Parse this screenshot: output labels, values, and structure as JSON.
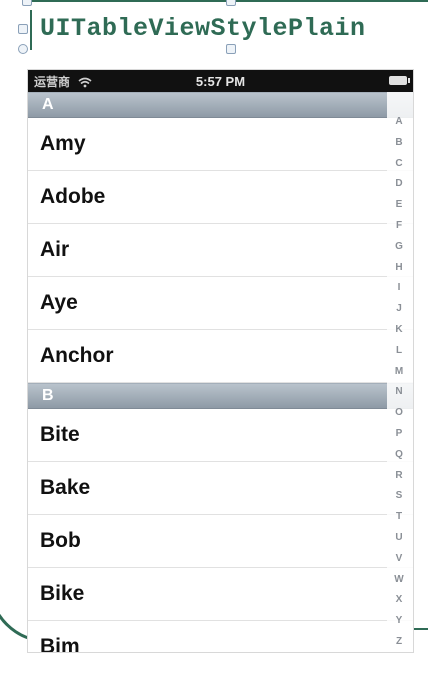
{
  "annotation": {
    "title": "UITableViewStylePlain"
  },
  "status_bar": {
    "carrier": "运营商",
    "time": "5:57 PM"
  },
  "table": {
    "sections": [
      {
        "header": "A",
        "rows": [
          "Amy",
          "Adobe",
          "Air",
          "Aye",
          "Anchor"
        ]
      },
      {
        "header": "B",
        "rows": [
          "Bite",
          "Bake",
          "Bob",
          "Bike",
          "Bim"
        ]
      }
    ],
    "index": [
      "A",
      "B",
      "C",
      "D",
      "E",
      "F",
      "G",
      "H",
      "I",
      "J",
      "K",
      "L",
      "M",
      "N",
      "O",
      "P",
      "Q",
      "R",
      "S",
      "T",
      "U",
      "V",
      "W",
      "X",
      "Y",
      "Z"
    ]
  },
  "colors": {
    "annotation": "#2f6b55",
    "section_header": "#9aa6b2",
    "status_bar": "#111111"
  }
}
